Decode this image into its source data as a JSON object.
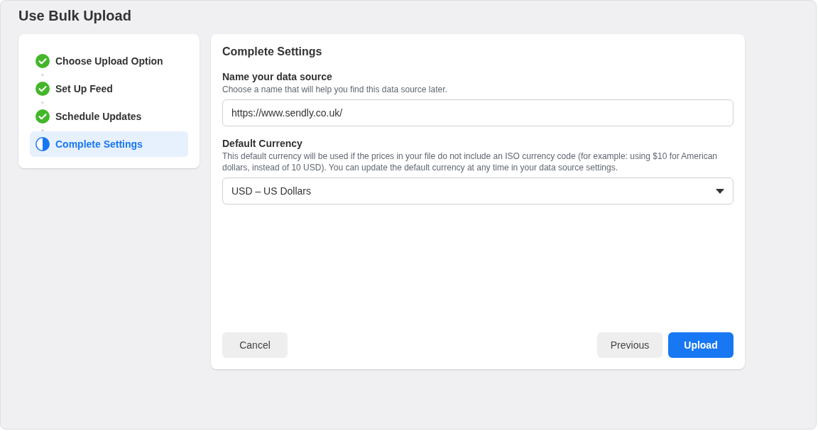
{
  "title": "Use Bulk Upload",
  "steps": [
    {
      "label": "Choose Upload Option",
      "kind": "done",
      "selected": false
    },
    {
      "label": "Set Up Feed",
      "kind": "done",
      "selected": false
    },
    {
      "label": "Schedule Updates",
      "kind": "done",
      "selected": false
    },
    {
      "label": "Complete Settings",
      "kind": "current",
      "selected": true
    }
  ],
  "panel": {
    "heading": "Complete Settings",
    "name_field": {
      "label": "Name your data source",
      "help": "Choose a name that will help you find this data source later.",
      "value": "https://www.sendly.co.uk/"
    },
    "currency_field": {
      "label": "Default Currency",
      "help": "This default currency will be used if the prices in your file do not include an ISO currency code (for example: using $10 for American dollars, instead of 10 USD). You can update the default currency at any time in your data source settings.",
      "value": "USD – US Dollars"
    }
  },
  "buttons": [
    {
      "label": "Cancel",
      "kind": "secondary"
    },
    {
      "label": "Previous",
      "kind": "secondary"
    },
    {
      "label": "Upload",
      "kind": "primary"
    }
  ]
}
